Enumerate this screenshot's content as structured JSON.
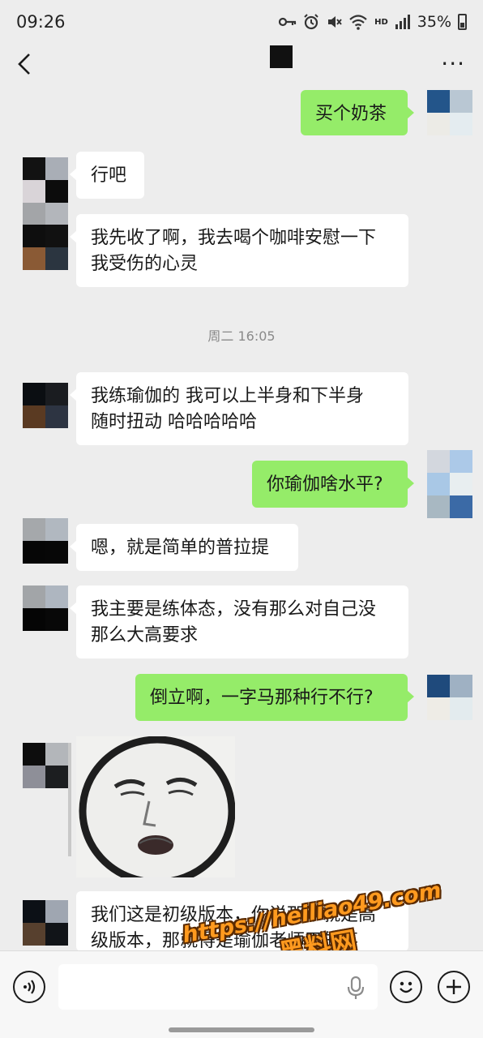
{
  "status_bar": {
    "time": "09:26",
    "battery": "35%",
    "network": "HD",
    "icons": [
      "key-icon",
      "alarm-icon",
      "mute-icon",
      "wifi-icon",
      "signal-icon",
      "battery-icon"
    ]
  },
  "nav": {
    "back_icon": "chevron-left-icon",
    "more_icon": "more-icon",
    "more_label": "···"
  },
  "messages": [
    {
      "side": "out",
      "text": "买个奶茶"
    },
    {
      "side": "in",
      "text": "行吧"
    },
    {
      "side": "in",
      "text": "我先收了啊，我去喝个咖啡安慰一下\n我受伤的心灵"
    },
    {
      "side": "in",
      "text": "我练瑜伽的 我可以上半身和下半身\n随时扭动 哈哈哈哈哈"
    },
    {
      "side": "out",
      "text": "你瑜伽啥水平?"
    },
    {
      "side": "in",
      "text": "嗯，就是简单的普拉提"
    },
    {
      "side": "in",
      "text": "我主要是练体态，没有那么对自己没\n那么大高要求"
    },
    {
      "side": "out",
      "text": "倒立啊，一字马那种行不行?"
    },
    {
      "side": "in",
      "type": "sticker"
    },
    {
      "side": "in",
      "text": "我们这是初级版本，你说那个就是高\n级版本，那就得是瑜伽老师干的事"
    }
  ],
  "timestamp": "周二 16:05",
  "watermark": {
    "url": "https://heiliao49.com",
    "name": "黑料网"
  },
  "input_bar": {
    "voice_icon": "voice-icon",
    "mic_icon": "mic-icon",
    "emoji_icon": "emoji-icon",
    "plus_icon": "plus-icon"
  },
  "colors": {
    "background": "#ededed",
    "outgoing_bubble": "#95ec69",
    "incoming_bubble": "#ffffff",
    "watermark": "#ff9a1f"
  }
}
